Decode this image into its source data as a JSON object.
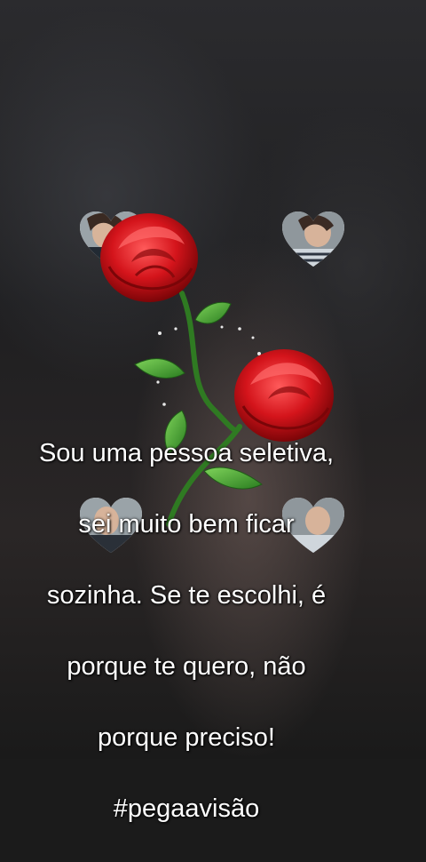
{
  "video": {
    "caption_lines": [
      "Sou uma pessoa seletiva,",
      "sei muito bem ficar",
      "sozinha. Se te escolhi, é",
      "porque te quero, não",
      "porque preciso!",
      "#pegaavisão"
    ]
  },
  "sticker": {
    "icon": "rose-bouquet-icon",
    "rose_color": "#d4141b",
    "leaf_color": "#3a9b2c",
    "frame_icon": "heart-photo-frame-icon"
  }
}
